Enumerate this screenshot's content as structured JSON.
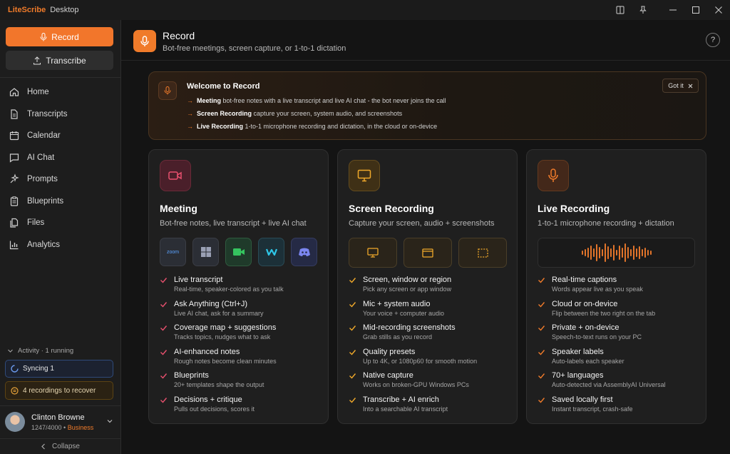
{
  "titlebar": {
    "app_name": "LiteScribe",
    "app_sub": "Desktop"
  },
  "sidebar": {
    "record_label": "Record",
    "transcribe_label": "Transcribe",
    "nav": [
      {
        "label": "Home",
        "icon": "home-icon"
      },
      {
        "label": "Transcripts",
        "icon": "document-icon"
      },
      {
        "label": "Calendar",
        "icon": "calendar-icon"
      },
      {
        "label": "AI Chat",
        "icon": "chat-icon"
      },
      {
        "label": "Prompts",
        "icon": "sparkle-icon"
      },
      {
        "label": "Blueprints",
        "icon": "clipboard-icon"
      },
      {
        "label": "Files",
        "icon": "files-icon"
      },
      {
        "label": "Analytics",
        "icon": "chart-icon"
      }
    ],
    "activity": "Activity · 1 running",
    "syncing": "Syncing 1",
    "recover": "4 recordings to recover",
    "user": {
      "name": "Clinton Browne",
      "usage": "1247/4000",
      "sep": " • ",
      "plan": "Business"
    },
    "collapse": "Collapse"
  },
  "header": {
    "title": "Record",
    "subtitle": "Bot-free meetings, screen capture, or 1-to-1 dictation",
    "help": "?"
  },
  "welcome": {
    "title": "Welcome to Record",
    "got_it": "Got it",
    "lines": [
      {
        "bold": "Meeting",
        "text": " bot-free notes with a live transcript and live AI chat - the bot never joins the call"
      },
      {
        "bold": "Screen Recording",
        "text": " capture your screen, system audio, and screenshots"
      },
      {
        "bold": "Live Recording",
        "text": " 1-to-1 microphone recording and dictation, in the cloud or on-device"
      }
    ]
  },
  "cards": [
    {
      "title": "Meeting",
      "subtitle": "Bot-free notes, live transcript + live AI chat",
      "accent": "#e8506e",
      "apps": [
        {
          "name": "zoom-icon",
          "label": "zoom"
        },
        {
          "name": "teams-icon",
          "label": ""
        },
        {
          "name": "meet-icon",
          "label": ""
        },
        {
          "name": "webex-icon",
          "label": ""
        },
        {
          "name": "discord-icon",
          "label": ""
        }
      ],
      "features": [
        {
          "title": "Live transcript",
          "desc": "Real-time, speaker-colored as you talk"
        },
        {
          "title": "Ask Anything (Ctrl+J)",
          "desc": "Live AI chat, ask for a summary"
        },
        {
          "title": "Coverage map + suggestions",
          "desc": "Tracks topics, nudges what to ask"
        },
        {
          "title": "AI-enhanced notes",
          "desc": "Rough notes become clean minutes"
        },
        {
          "title": "Blueprints",
          "desc": "20+ templates shape the output"
        },
        {
          "title": "Decisions + critique",
          "desc": "Pulls out decisions, scores it"
        }
      ]
    },
    {
      "title": "Screen Recording",
      "subtitle": "Capture your screen, audio + screenshots",
      "accent": "#f0a92a",
      "capture_icons": [
        "monitor-icon",
        "window-icon",
        "region-icon"
      ],
      "features": [
        {
          "title": "Screen, window or region",
          "desc": "Pick any screen or app window"
        },
        {
          "title": "Mic + system audio",
          "desc": "Your voice + computer audio"
        },
        {
          "title": "Mid-recording screenshots",
          "desc": "Grab stills as you record"
        },
        {
          "title": "Quality presets",
          "desc": "Up to 4K, or 1080p60 for smooth motion"
        },
        {
          "title": "Native capture",
          "desc": "Works on broken-GPU Windows PCs"
        },
        {
          "title": "Transcribe + AI enrich",
          "desc": "Into a searchable AI transcript"
        }
      ]
    },
    {
      "title": "Live Recording",
      "subtitle": "1-to-1 microphone recording + dictation",
      "accent": "#f07b2a",
      "features": [
        {
          "title": "Real-time captions",
          "desc": "Words appear live as you speak"
        },
        {
          "title": "Cloud or on-device",
          "desc": "Flip between the two right on the tab"
        },
        {
          "title": "Private + on-device",
          "desc": "Speech-to-text runs on your PC"
        },
        {
          "title": "Speaker labels",
          "desc": "Auto-labels each speaker"
        },
        {
          "title": "70+ languages",
          "desc": "Auto-detected via AssemblyAI Universal"
        },
        {
          "title": "Saved locally first",
          "desc": "Instant transcript, crash-safe"
        }
      ]
    }
  ]
}
